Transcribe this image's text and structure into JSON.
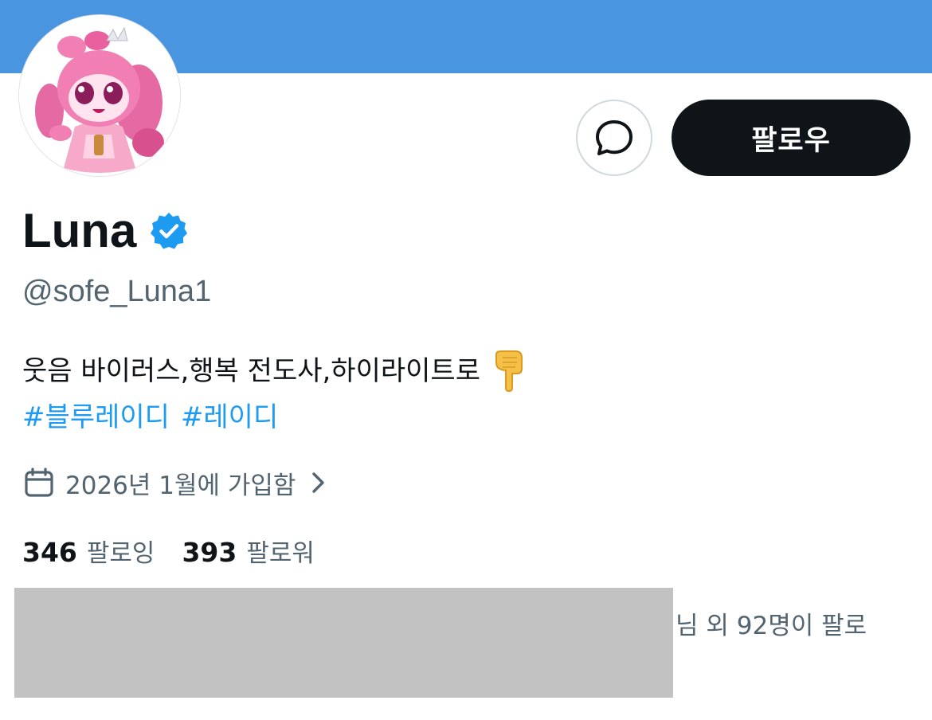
{
  "profile": {
    "display_name": "Luna",
    "handle": "@sofe_Luna1",
    "verified_icon": "verified-badge-icon",
    "avatar_icon": "pink-character-avatar"
  },
  "actions": {
    "message_icon": "message-icon",
    "follow_label": "팔로우"
  },
  "bio": {
    "line1": "웃음 바이러스,행복 전도사,하이라이트로",
    "emoji": "backhand-pointing-down-emoji",
    "hashtags": [
      "#블루레이디",
      "#레이디"
    ]
  },
  "joined": {
    "icon": "calendar-icon",
    "text": "2026년 1월에 가입함",
    "chevron_icon": "chevron-right-icon"
  },
  "stats": {
    "following_count": "346",
    "following_label": "팔로잉",
    "followers_count": "393",
    "followers_label": "팔로워"
  },
  "followed_by": {
    "text": "님 외 92명이 팔로"
  },
  "colors": {
    "banner": "#4a95e0",
    "accent": "#1d9bf0",
    "text_primary": "#0f1419",
    "text_secondary": "#536471",
    "follow_button_bg": "#0f1419",
    "redaction": "#c2c2c2"
  }
}
